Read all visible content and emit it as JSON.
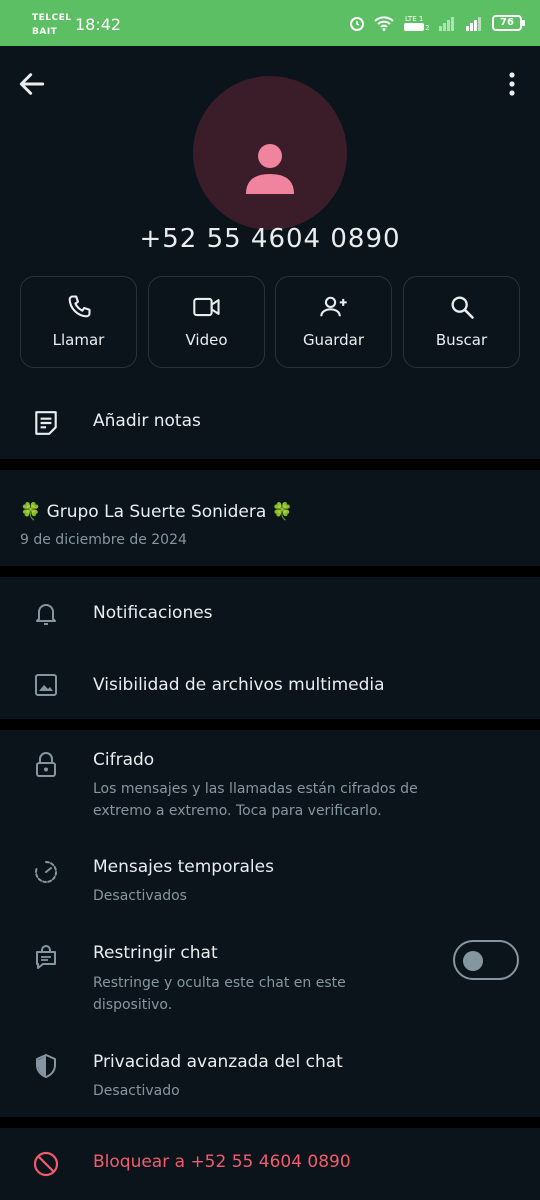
{
  "status_bar": {
    "carrier_line1": "TELCEL",
    "carrier_line2": "BAIT",
    "time": "18:42",
    "battery": "76"
  },
  "header": {
    "back_icon": "arrow-left-icon",
    "menu_icon": "more-vert-icon"
  },
  "contact": {
    "avatar_icon": "person-icon",
    "phone": "+52 55 4604 0890"
  },
  "actions": [
    {
      "label": "Llamar",
      "icon": "phone-icon"
    },
    {
      "label": "Video",
      "icon": "video-icon"
    },
    {
      "label": "Guardar",
      "icon": "add-contact-icon"
    },
    {
      "label": "Buscar",
      "icon": "search-icon"
    }
  ],
  "notes": {
    "label": "Añadir notas",
    "icon": "note-icon"
  },
  "group": {
    "name": "🍀 Grupo La Suerte Sonidera 🍀",
    "date": "9 de diciembre de 2024"
  },
  "settings": {
    "notifications": {
      "title": "Notificaciones",
      "icon": "bell-icon"
    },
    "media_visibility": {
      "title": "Visibilidad de archivos multimedia",
      "icon": "image-icon"
    }
  },
  "privacy": {
    "encryption": {
      "title": "Cifrado",
      "sub1": "Los mensajes y las llamadas están cifrados de",
      "sub2": "extremo a extremo. Toca para verificarlo.",
      "icon": "lock-icon"
    },
    "disappearing": {
      "title": "Mensajes temporales",
      "sub": "Desactivados",
      "icon": "timer-icon"
    },
    "restrict": {
      "title": "Restringir chat",
      "sub1": "Restringe y oculta este chat en este",
      "sub2": "dispositivo.",
      "icon": "chat-lock-icon",
      "enabled": false
    },
    "advanced": {
      "title": "Privacidad avanzada del chat",
      "sub": "Desactivado",
      "icon": "shield-icon"
    }
  },
  "block": {
    "label": "Bloquear a +52 55 4604 0890",
    "icon": "block-icon"
  },
  "colors": {
    "status_bar": "#5cbf63",
    "background": "#0b141a",
    "avatar_bg": "#3b1d2a",
    "avatar_icon": "#f0839d",
    "danger": "#f15c6d"
  }
}
